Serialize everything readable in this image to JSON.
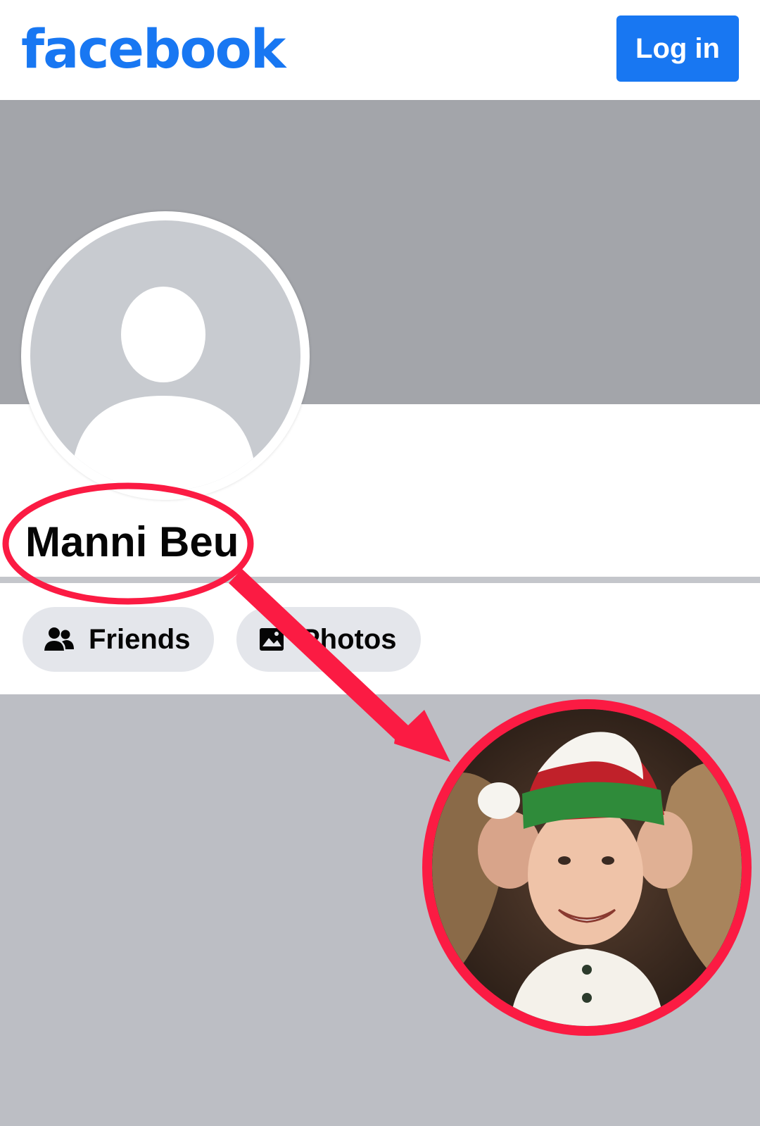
{
  "header": {
    "logo_text": "facebook",
    "login_label": "Log in"
  },
  "profile": {
    "name": "Manni Beu"
  },
  "tabs": [
    {
      "label": "Friends",
      "icon": "friends-icon"
    },
    {
      "label": "Photos",
      "icon": "photos-icon"
    }
  ],
  "colors": {
    "brand_blue": "#1877f2",
    "annotation_red": "#fb1b43",
    "cover_gray": "#a3a5aa",
    "page_gray": "#bcbec4",
    "pill_gray": "#e4e6eb"
  }
}
